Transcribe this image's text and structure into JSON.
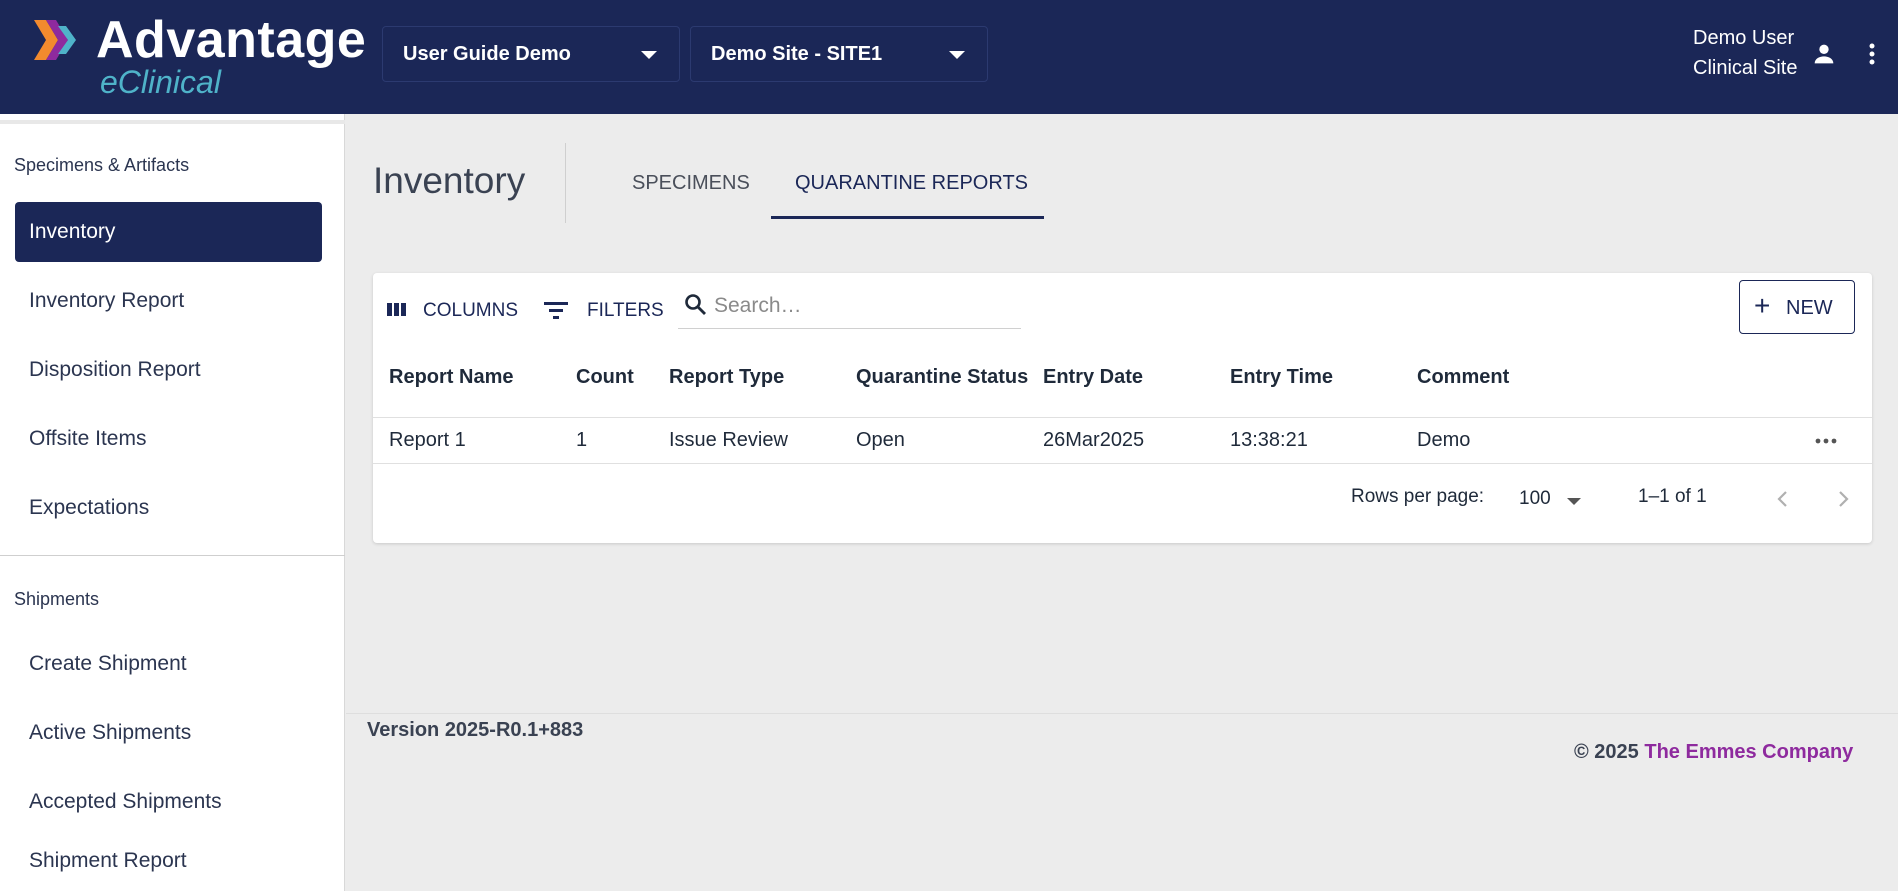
{
  "header": {
    "brand_title": "Advantage",
    "brand_subtitle": "eClinical",
    "study_select": "User Guide Demo",
    "site_select": "Demo Site - SITE1",
    "user_name": "Demo User",
    "user_role": "Clinical Site",
    "icons": {
      "user": "person-icon",
      "menu": "more-vert-icon"
    },
    "colors": {
      "header_bg": "#1b2757",
      "brand_accent": "#4fb3c9"
    }
  },
  "sidebar": {
    "section1_title": "Specimens & Artifacts",
    "section1_items": [
      {
        "label": "Inventory",
        "active": true
      },
      {
        "label": "Inventory Report"
      },
      {
        "label": "Disposition Report"
      },
      {
        "label": "Offsite Items"
      },
      {
        "label": "Expectations"
      }
    ],
    "section2_title": "Shipments",
    "section2_items": [
      {
        "label": "Create Shipment"
      },
      {
        "label": "Active Shipments"
      },
      {
        "label": "Accepted Shipments"
      },
      {
        "label": "Shipment Report"
      }
    ]
  },
  "main": {
    "page_title": "Inventory",
    "tabs": [
      {
        "label": "SPECIMENS",
        "active": false
      },
      {
        "label": "QUARANTINE REPORTS",
        "active": true
      }
    ]
  },
  "toolbar": {
    "columns_label": "COLUMNS",
    "filters_label": "FILTERS",
    "search_placeholder": "Search…",
    "search_value": "",
    "new_label": "NEW"
  },
  "table": {
    "columns": [
      "Report Name",
      "Count",
      "Report Type",
      "Quarantine Status",
      "Entry Date",
      "Entry Time",
      "Comment"
    ],
    "rows": [
      [
        "Report 1",
        "1",
        "Issue Review",
        "Open",
        "26Mar2025",
        "13:38:21",
        "Demo"
      ]
    ]
  },
  "pagination": {
    "rows_per_page_label": "Rows per page:",
    "rows_per_page": "100",
    "range": "1–1 of 1"
  },
  "footer": {
    "version": "Version 2025-R0.1+883",
    "copyright": "© 2025",
    "company": "The Emmes Company"
  }
}
